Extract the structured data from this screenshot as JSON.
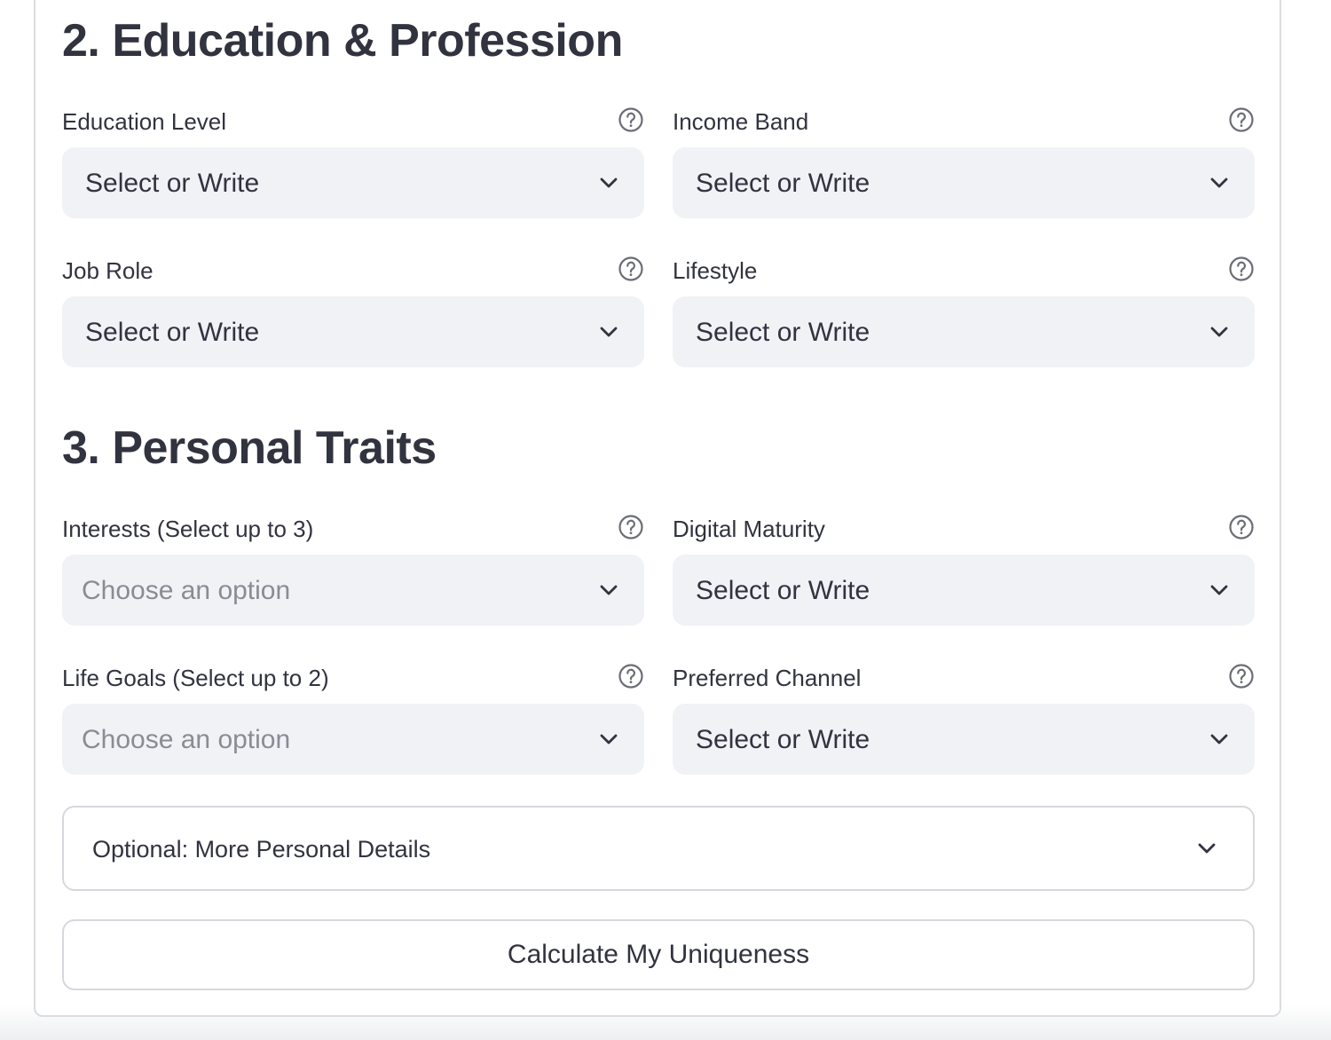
{
  "sections": [
    {
      "title": "2. Education & Profession",
      "fields": [
        {
          "label": "Education Level",
          "value": "Select or Write",
          "is_placeholder": false
        },
        {
          "label": "Income Band",
          "value": "Select or Write",
          "is_placeholder": false
        },
        {
          "label": "Job Role",
          "value": "Select or Write",
          "is_placeholder": false
        },
        {
          "label": "Lifestyle",
          "value": "Select or Write",
          "is_placeholder": false
        }
      ]
    },
    {
      "title": "3. Personal Traits",
      "fields": [
        {
          "label": "Interests (Select up to 3)",
          "value": "Choose an option",
          "is_placeholder": true
        },
        {
          "label": "Digital Maturity",
          "value": "Select or Write",
          "is_placeholder": false
        },
        {
          "label": "Life Goals (Select up to 2)",
          "value": "Choose an option",
          "is_placeholder": true
        },
        {
          "label": "Preferred Channel",
          "value": "Select or Write",
          "is_placeholder": false
        }
      ]
    }
  ],
  "expander": {
    "label": "Optional: More Personal Details",
    "icon": "chevron-down-icon"
  },
  "submit": {
    "label": "Calculate My Uniqueness"
  },
  "icons": {
    "help": "question-circle-icon",
    "dropdown": "chevron-down-icon"
  },
  "colors": {
    "text": "#31333f",
    "placeholder": "#8a8c94",
    "select_background": "#f0f2f6",
    "border": "#d6d8dd",
    "help_icon": "#6b6d75"
  }
}
